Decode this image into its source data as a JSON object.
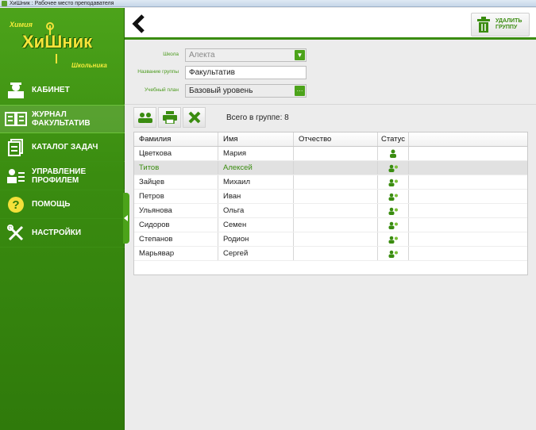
{
  "window": {
    "title": "ХиШник : Рабочее место преподавателя"
  },
  "logo": {
    "top": "Химия",
    "main": "ХиШник",
    "bottom": "Школьника"
  },
  "sidebar": {
    "items": [
      {
        "label": "КАБИНЕТ",
        "icon": "teacher-icon"
      },
      {
        "label": "ЖУРНАЛ\nФАКУЛЬТАТИВ",
        "icon": "journal-icon",
        "active": true
      },
      {
        "label": "КАТАЛОГ ЗАДАЧ",
        "icon": "catalog-icon"
      },
      {
        "label": "УПРАВЛЕНИЕ\nПРОФИЛЕМ",
        "icon": "profile-icon"
      },
      {
        "label": "ПОМОЩЬ",
        "icon": "help-icon"
      },
      {
        "label": "НАСТРОЙКИ",
        "icon": "settings-icon"
      }
    ]
  },
  "header": {
    "delete_label": "УДАЛИТЬ\nГРУППУ"
  },
  "form": {
    "school_label": "Школа",
    "school_value": "Алекта",
    "group_label": "Название группы",
    "group_value": "Факультатив",
    "plan_label": "Учебный план",
    "plan_value": "Базовый уровень"
  },
  "toolbar": {
    "count_text": "Всего в группе: 8"
  },
  "table": {
    "headers": [
      "Фамилия",
      "Имя",
      "Отчество",
      "Статус"
    ],
    "rows": [
      {
        "last": "Цветкова",
        "first": "Мария",
        "middle": ""
      },
      {
        "last": "Титов",
        "first": "Алексей",
        "middle": ""
      },
      {
        "last": "Зайцев",
        "first": "Михаил",
        "middle": ""
      },
      {
        "last": "Петров",
        "first": "Иван",
        "middle": ""
      },
      {
        "last": "Ульянова",
        "first": "Ольга",
        "middle": ""
      },
      {
        "last": "Сидоров",
        "first": "Семен",
        "middle": ""
      },
      {
        "last": "Степанов",
        "first": "Родион",
        "middle": ""
      },
      {
        "last": "Марьявар",
        "first": "Сергей",
        "middle": ""
      }
    ]
  },
  "colors": {
    "accent": "#3a8c10",
    "sidebar": "#4ca31a",
    "logo": "#f7e43a"
  }
}
